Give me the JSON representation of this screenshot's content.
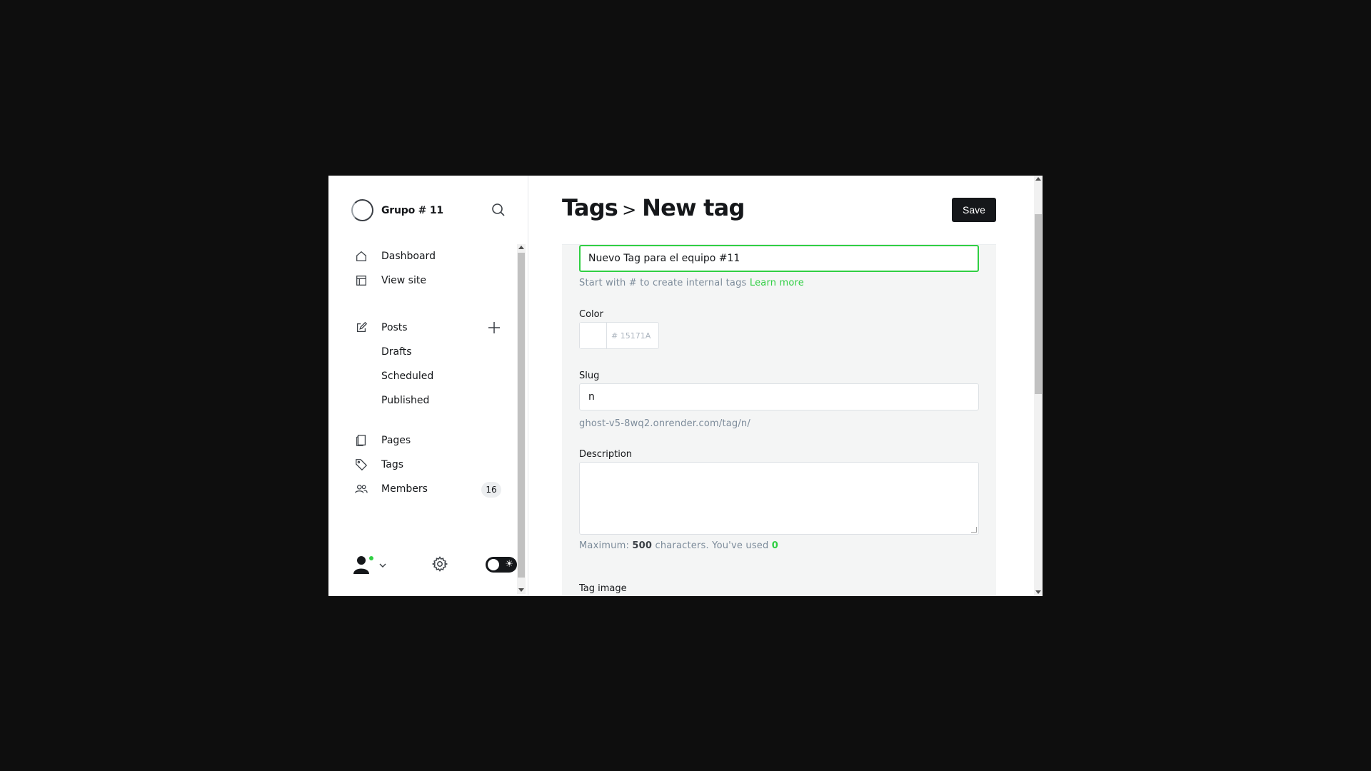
{
  "sidebar": {
    "site_name": "Grupo # 11",
    "nav": {
      "dashboard": "Dashboard",
      "view_site": "View site",
      "posts": "Posts",
      "drafts": "Drafts",
      "scheduled": "Scheduled",
      "published": "Published",
      "pages": "Pages",
      "tags": "Tags",
      "members": "Members",
      "members_count": "16"
    },
    "icons": {
      "search": "search-icon",
      "dashboard": "home-icon",
      "view_site": "layout-icon",
      "posts": "edit-icon",
      "new_post": "plus-icon",
      "pages": "page-icon",
      "tags": "tag-icon",
      "members": "members-icon",
      "settings": "gear-icon",
      "theme": "sun-icon"
    }
  },
  "header": {
    "breadcrumb_parent": "Tags",
    "breadcrumb_separator": ">",
    "title": "New tag",
    "save_label": "Save"
  },
  "form": {
    "name_value": "Nuevo Tag para el equipo #11",
    "name_hint_prefix": "Start with # to create internal tags",
    "name_hint_link": "Learn more",
    "color_label": "Color",
    "color_placeholder": "# 15171A",
    "slug_label": "Slug",
    "slug_value": "n",
    "slug_url": "ghost-v5-8wq2.onrender.com/tag/n/",
    "description_label": "Description",
    "description_value": "",
    "desc_count_prefix": "Maximum:",
    "desc_max": "500",
    "desc_count_mid": "characters. You've used",
    "desc_used": "0",
    "tag_image_label": "Tag image"
  },
  "colors": {
    "accent_green": "#30cf43",
    "dark": "#15171a"
  }
}
